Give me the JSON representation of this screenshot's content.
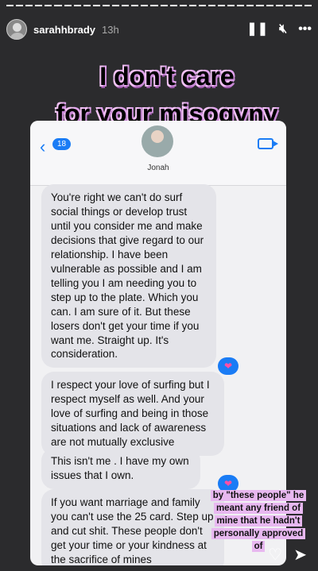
{
  "story": {
    "username": "sarahhbrady",
    "time": "13h",
    "segments": 32,
    "sticker_line1": "I don't care",
    "sticker_line2": "for your misogyny"
  },
  "phone": {
    "badge": "18",
    "contact_name": "Jonah",
    "messages": [
      "You're right we can't do surf social things or develop trust until you consider me and make decisions that give regard to our relationship. I have been vulnerable as possible and I am telling you I am needing you to step up to the plate. Which you can. I am sure of it. But these losers don't get your time if you want me. Straight up. It's consideration.",
      "I respect your love of surfing but I respect myself as well. And your love of surfing and being in those situations and lack of awareness are not mutually exclusive",
      "This isn't me . I have my own issues that I own.",
      "If you want marriage and family you can't use the 25 card. Step up and cut shit. These people don't get your time or your kindness at the sacrifice of mines"
    ]
  },
  "caption": "by \"these people\" he meant any friend of mine that he hadn't personally approved of",
  "icons": {
    "pause": "pause-icon",
    "mute": "mute-icon",
    "more": "more-icon",
    "heart": "heart-icon",
    "share": "send-icon"
  }
}
